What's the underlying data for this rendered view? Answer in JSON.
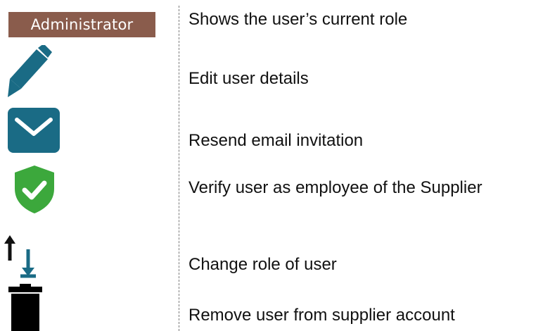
{
  "legend": {
    "items": [
      {
        "icon": "role-badge",
        "badge_label": "Administrator",
        "description": "Shows the user’s current role"
      },
      {
        "icon": "pencil-icon",
        "description": "Edit user details"
      },
      {
        "icon": "envelope-icon",
        "description": "Resend email invitation"
      },
      {
        "icon": "shield-check-icon",
        "description": "Verify user as employee of the Supplier"
      },
      {
        "icon": "swap-arrows-icon",
        "description": "Change role of user"
      },
      {
        "icon": "trash-icon",
        "description": "Remove user from supplier account"
      }
    ]
  },
  "colors": {
    "badge_background": "#8a5c4c",
    "teal_icon": "#1a6b85",
    "shield_green": "#3ca83c",
    "arrow_up": "#111111",
    "arrow_down": "#1a6b85",
    "trash": "#000000"
  }
}
